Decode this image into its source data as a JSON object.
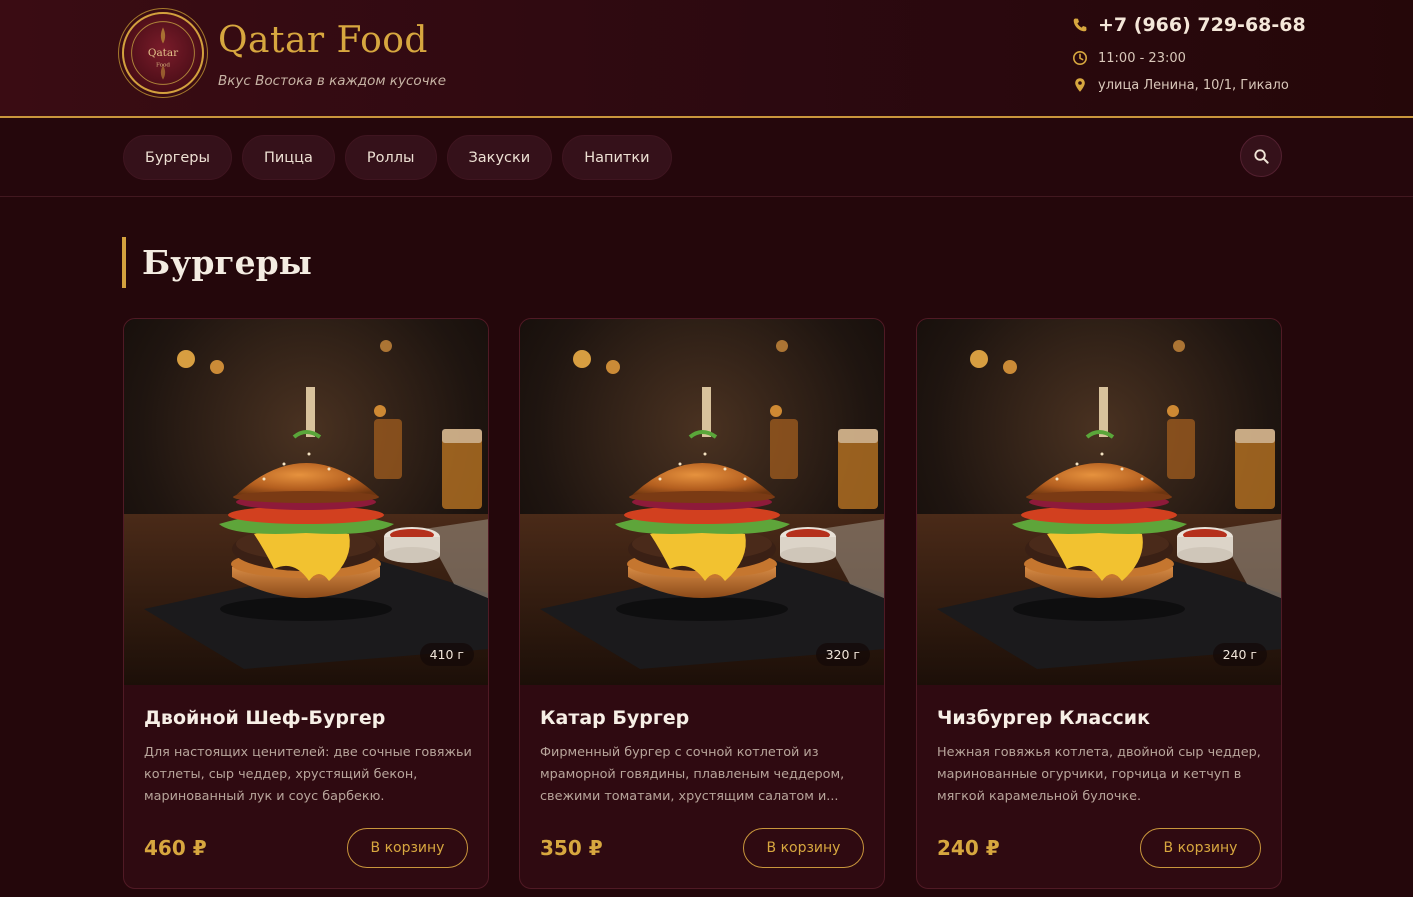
{
  "brand": {
    "title": "Qatar Food",
    "tagline": "Вкус Востока в каждом кусочке",
    "logo_text": "Qatar",
    "logo_subtext": "Food",
    "accent_color": "#d7a73f"
  },
  "contact": {
    "phone": "+7 (966) 729-68-68",
    "hours": "11:00 - 23:00",
    "address": "улица Ленина, 10/1, Гикало",
    "icons": [
      "phone-icon",
      "clock-icon",
      "location-pin-icon"
    ]
  },
  "nav": {
    "items": [
      {
        "label": "Бургеры"
      },
      {
        "label": "Пицца"
      },
      {
        "label": "Роллы"
      },
      {
        "label": "Закуски"
      },
      {
        "label": "Напитки"
      }
    ],
    "search_icon": "search-icon"
  },
  "section": {
    "title": "Бургеры"
  },
  "cards": [
    {
      "title": "Двойной Шеф-Бургер",
      "desc": "Для настоящих ценителей: две сочные говяжьи котлеты, сыр чеддер, хрустящий бекон, маринованный лук и соус барбекю.",
      "weight": "410 г",
      "price": "460 ₽",
      "button": "В корзину"
    },
    {
      "title": "Катар Бургер",
      "desc": "Фирменный бургер с сочной котлетой из мраморной говядины, плавленым чеддером, свежими томатами, хрустящим салатом и...",
      "weight": "320 г",
      "price": "350 ₽",
      "button": "В корзину"
    },
    {
      "title": "Чизбургер Классик",
      "desc": "Нежная говяжья котлета, двойной сыр чеддер, маринованные огурчики, горчица и кетчуп в мягкой карамельной булочке.",
      "weight": "240 г",
      "price": "240 ₽",
      "button": "В корзину"
    }
  ]
}
